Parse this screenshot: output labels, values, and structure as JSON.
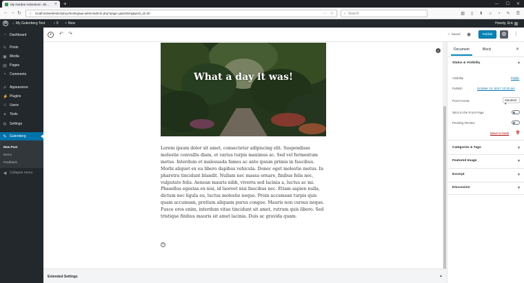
{
  "browser": {
    "tab_title": "My Garden Adventure ‹ Bl…",
    "url": "localhost/web/steckyboy/testing/wp-admin/admin.php?page=gutenberg&post_id=20",
    "search_placeholder": "Search"
  },
  "adminbar": {
    "site_name": "My Gutenberg Test",
    "comments_count": "0",
    "new_label": "New",
    "howdy": "Howdy, Eric"
  },
  "menu": {
    "items": [
      {
        "label": "Dashboard",
        "icon": "dashboard-icon"
      },
      {
        "label": "Posts",
        "icon": "pin-icon"
      },
      {
        "label": "Media",
        "icon": "media-icon"
      },
      {
        "label": "Pages",
        "icon": "pages-icon"
      },
      {
        "label": "Comments",
        "icon": "comments-icon"
      },
      {
        "label": "Appearance",
        "icon": "brush-icon"
      },
      {
        "label": "Plugins",
        "icon": "plugin-icon"
      },
      {
        "label": "Users",
        "icon": "users-icon"
      },
      {
        "label": "Tools",
        "icon": "wrench-icon"
      },
      {
        "label": "Settings",
        "icon": "settings-icon"
      },
      {
        "label": "Gutenberg",
        "icon": "edit-icon"
      }
    ],
    "submenu": [
      "New Post",
      "Demo",
      "Feedback"
    ],
    "collapse": "Collapse menu"
  },
  "editor": {
    "saved": "Saved",
    "publish": "Publish"
  },
  "cover": {
    "title": "What a day it was!"
  },
  "paragraph": "Lorem ipsum dolor sit amet, consectetur adipiscing elit. Suspendisse molestie convallis diam, et varius turpis maximus ac. Sed vel fermentum metus. Interdum et malesuada fames ac ante ipsum primis in faucibus. Morbi aliquet ex eu libero dapibus vehicula. Donec eget molestie metus. In pharetra tincidunt blandit. Nullam nec massa ornare, finibus felis nec, vulputate felis. Aenean mauris nibh, viverra sed lacinia a, luctus ac mi. Phasellus egestas ex nisi, id laoreet nisi faucibus nec. Etiam sapien nulla, dictum nec ligula eu, luctus molestie neque. Proin accumsan turpis quis quam accumsan, pretium aliquam purus congue. Mauris non cursus neque. Fusce eros enim, interdum vitae tincidunt sit amet, rutrum quis libero. Sed tristique finibus mauris sit amet lacinia. Duis ac gravida quam.",
  "sidebar": {
    "tab_document": "Document",
    "tab_block": "Block",
    "status_title": "Status & Visibility",
    "visibility_label": "Visibility",
    "visibility_value": "Public",
    "publish_label": "Publish",
    "publish_value": "October 12, 2017 12:23 pm",
    "format_label": "Post Format",
    "format_value": "Standard",
    "sticky_label": "Stick to the Front Page",
    "pending_label": "Pending Review",
    "trash": "Move to trash",
    "panels": [
      "Categories & Tags",
      "Featured Image",
      "Excerpt",
      "Discussion"
    ]
  },
  "extended": "Extended Settings",
  "colors": {
    "accent": "#0073aa",
    "publish": "#0085ba",
    "adminbar": "#23282d"
  }
}
